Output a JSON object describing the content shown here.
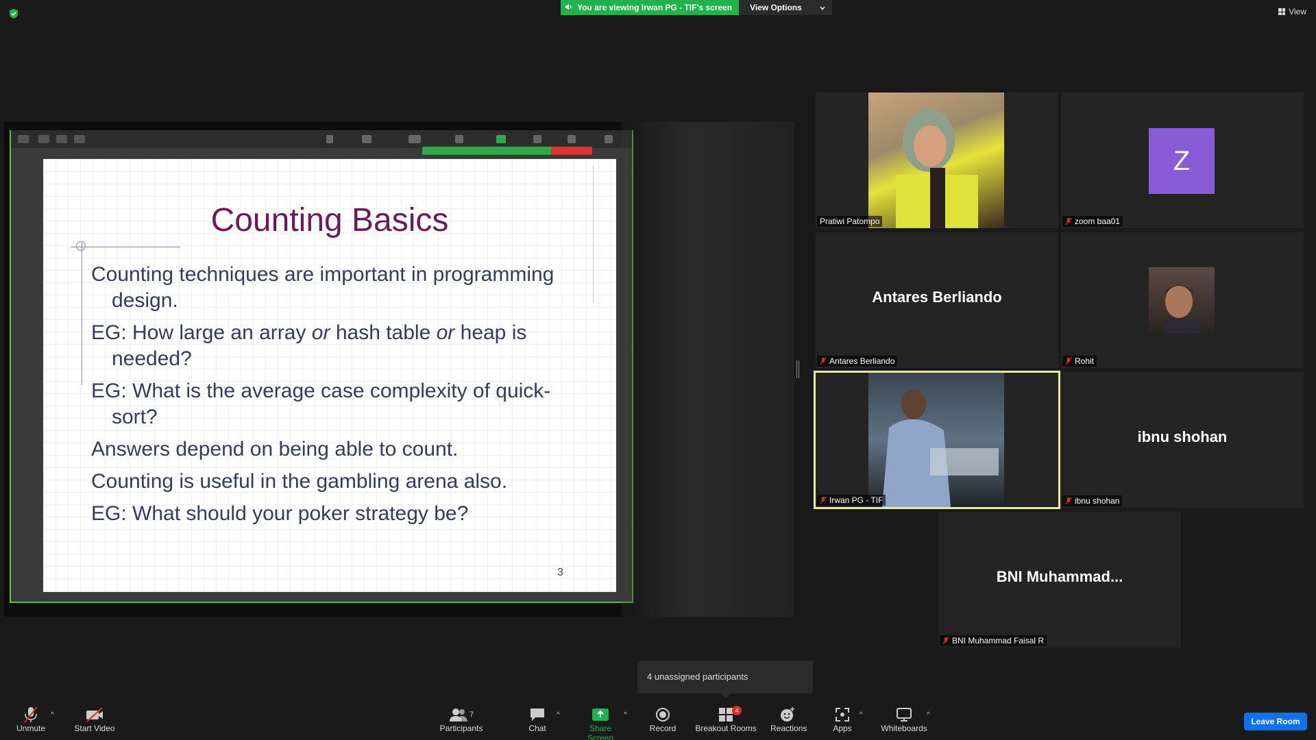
{
  "top": {
    "banner_text": "You are viewing Irwan PG - TIF's screen",
    "view_options": "View Options",
    "view_label": "View"
  },
  "slide": {
    "title": "Counting Basics",
    "bullets": [
      {
        "a": "Counting techniques are important in programming design."
      },
      {
        "a": "EG:  How large an array ",
        "b": "or",
        "c": " hash table ",
        "d": "or",
        "e": " heap is needed?"
      },
      {
        "a": "EG:  What is the average case complexity of quick-sort?"
      },
      {
        "a": "Answers depend on being able to count."
      },
      {
        "a": "Counting is useful in the gambling arena also."
      },
      {
        "a": "EG:  What should your poker strategy be?"
      }
    ],
    "page_number": "3"
  },
  "participants_tiles": [
    {
      "name": "Pratiwi Patompo",
      "muted": false
    },
    {
      "name": "zoom baa01",
      "muted": true,
      "avatar_letter": "Z"
    },
    {
      "name": "Antares Berliando",
      "muted": true,
      "big_name": "Antares Berliando"
    },
    {
      "name": "Rohit",
      "muted": true
    },
    {
      "name": "Irwan PG - TIF",
      "muted": true
    },
    {
      "name": "ibnu shohan",
      "muted": true,
      "big_name": "ibnu shohan"
    },
    {
      "name": "BNI Muhammad Faisal R",
      "muted": true,
      "big_name": "BNI  Muhammad..."
    }
  ],
  "popover": {
    "text": "4 unassigned participants"
  },
  "toolbar": {
    "unmute": "Unmute",
    "start_video": "Start Video",
    "participants": "Participants",
    "participants_count": "7",
    "chat": "Chat",
    "share_screen": "Share Screen",
    "record": "Record",
    "breakout_rooms": "Breakout Rooms",
    "breakout_badge": "4",
    "reactions": "Reactions",
    "apps": "Apps",
    "whiteboards": "Whiteboards",
    "leave": "Leave Room"
  },
  "colors": {
    "accent_green": "#22b24c",
    "active_speaker_border": "#e8ec9a",
    "leave_blue": "#0e72ed",
    "slide_title": "#6b1a5a"
  }
}
